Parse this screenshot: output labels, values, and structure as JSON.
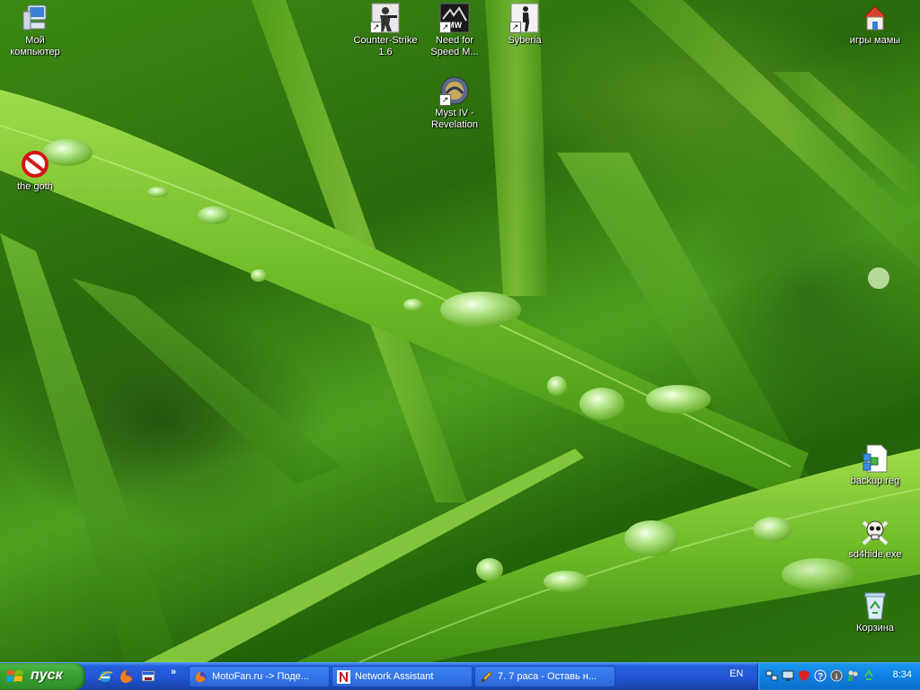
{
  "desktop": {
    "icons": [
      {
        "label": "Мой компьютер",
        "icon": "my-computer-icon"
      },
      {
        "label": "Counter-Strike 1.6",
        "icon": "counter-strike-icon"
      },
      {
        "label": "Need for Speed M...",
        "icon": "need-for-speed-icon"
      },
      {
        "label": "Syberia",
        "icon": "syberia-icon"
      },
      {
        "label": "игры мамы",
        "icon": "home-folder-icon"
      },
      {
        "label": "Myst IV - Revelation",
        "icon": "myst-icon"
      },
      {
        "label": "the goth",
        "icon": "no-entry-icon"
      },
      {
        "label": "backup.reg",
        "icon": "registry-file-icon"
      },
      {
        "label": "sd4hide.exe",
        "icon": "skull-icon"
      },
      {
        "label": "Корзина",
        "icon": "recycle-bin-icon"
      }
    ]
  },
  "taskbar": {
    "start_label": "пуск",
    "quick_launch": [
      "ie-icon",
      "firefox-icon",
      "show-desktop-icon"
    ],
    "quick_launch_more": "»",
    "tasks": [
      {
        "label": "MotoFan.ru -> Поде...",
        "icon": "firefox-icon"
      },
      {
        "label": "Network Assistant",
        "icon": "network-assistant-icon"
      },
      {
        "label": "7. 7 раса - Оставь н...",
        "icon": "pen-icon"
      }
    ],
    "language": "EN",
    "tray_icons": [
      "network-icon",
      "monitor-icon",
      "shield-icon",
      "help-icon",
      "info-icon",
      "users-icon",
      "recycle-icon"
    ],
    "clock": "8:34"
  },
  "colors": {
    "taskbar_blue": "#245edb",
    "start_green": "#37a22f",
    "tray_blue": "#0f80e0",
    "grass_green": "#3c8a14"
  }
}
